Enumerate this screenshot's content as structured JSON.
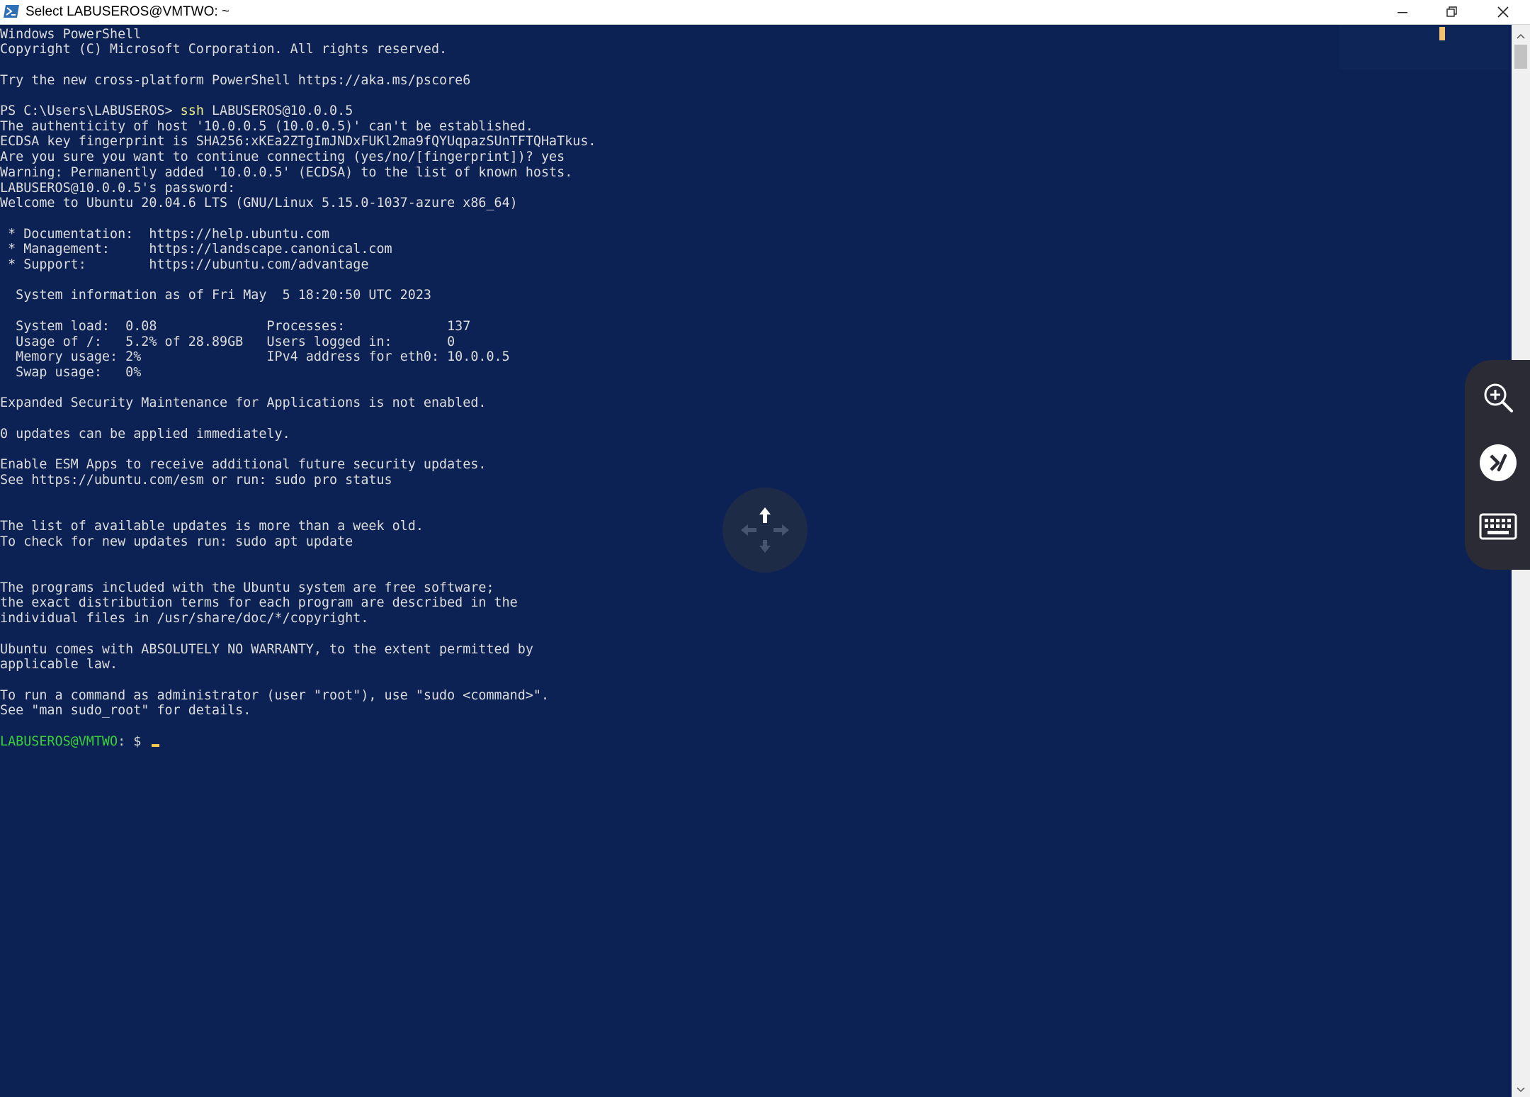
{
  "window": {
    "title": "Select LABUSEROS@VMTWO: ~",
    "app_icon": "powershell-icon",
    "controls": [
      "minimize-icon",
      "restore-icon",
      "close-icon"
    ]
  },
  "terminal": {
    "background": "#0c2254",
    "text_color": "#dcdcdc",
    "command_color": "#f1ef89",
    "prompt_color": "#38d13c",
    "lines": [
      {
        "text": "Windows PowerShell"
      },
      {
        "text": "Copyright (C) Microsoft Corporation. All rights reserved."
      },
      {
        "text": ""
      },
      {
        "text": "Try the new cross-platform PowerShell https://aka.ms/pscore6"
      },
      {
        "text": ""
      },
      {
        "text": "PS C:\\Users\\LABUSEROS> ",
        "cmd": "ssh",
        "rest": " LABUSEROS@10.0.0.5"
      },
      {
        "text": "The authenticity of host '10.0.0.5 (10.0.0.5)' can't be established."
      },
      {
        "text": "ECDSA key fingerprint is SHA256:xKEa2ZTgImJNDxFUKl2ma9fQYUqpazSUnTFTQHaTkus."
      },
      {
        "text": "Are you sure you want to continue connecting (yes/no/[fingerprint])? yes"
      },
      {
        "text": "Warning: Permanently added '10.0.0.5' (ECDSA) to the list of known hosts."
      },
      {
        "text": "LABUSEROS@10.0.0.5's password:"
      },
      {
        "text": "Welcome to Ubuntu 20.04.6 LTS (GNU/Linux 5.15.0-1037-azure x86_64)"
      },
      {
        "text": ""
      },
      {
        "text": " * Documentation:  https://help.ubuntu.com"
      },
      {
        "text": " * Management:     https://landscape.canonical.com"
      },
      {
        "text": " * Support:        https://ubuntu.com/advantage"
      },
      {
        "text": ""
      },
      {
        "text": "  System information as of Fri May  5 18:20:50 UTC 2023"
      },
      {
        "text": ""
      },
      {
        "text": "  System load:  0.08              Processes:             137"
      },
      {
        "text": "  Usage of /:   5.2% of 28.89GB   Users logged in:       0"
      },
      {
        "text": "  Memory usage: 2%                IPv4 address for eth0: 10.0.0.5"
      },
      {
        "text": "  Swap usage:   0%"
      },
      {
        "text": ""
      },
      {
        "text": "Expanded Security Maintenance for Applications is not enabled."
      },
      {
        "text": ""
      },
      {
        "text": "0 updates can be applied immediately."
      },
      {
        "text": ""
      },
      {
        "text": "Enable ESM Apps to receive additional future security updates."
      },
      {
        "text": "See https://ubuntu.com/esm or run: sudo pro status"
      },
      {
        "text": ""
      },
      {
        "text": ""
      },
      {
        "text": "The list of available updates is more than a week old."
      },
      {
        "text": "To check for new updates run: sudo apt update"
      },
      {
        "text": ""
      },
      {
        "text": ""
      },
      {
        "text": "The programs included with the Ubuntu system are free software;"
      },
      {
        "text": "the exact distribution terms for each program are described in the"
      },
      {
        "text": "individual files in /usr/share/doc/*/copyright."
      },
      {
        "text": ""
      },
      {
        "text": "Ubuntu comes with ABSOLUTELY NO WARRANTY, to the extent permitted by"
      },
      {
        "text": "applicable law."
      },
      {
        "text": ""
      },
      {
        "text": "To run a command as administrator (user \"root\"), use \"sudo <command>\"."
      },
      {
        "text": "See \"man sudo_root\" for details."
      },
      {
        "text": ""
      },
      {
        "prompt": "LABUSEROS@VMTWO",
        "text": ": $ ",
        "cursor": true
      }
    ]
  },
  "overlay": {
    "pan_widget_icon": "pan-move-icon",
    "side_toolbar": [
      {
        "name": "zoom-in",
        "icon": "zoom-in-icon"
      },
      {
        "name": "remote-desktop",
        "icon": "remote-desktop-icon"
      },
      {
        "name": "keyboard",
        "icon": "keyboard-icon"
      }
    ]
  }
}
